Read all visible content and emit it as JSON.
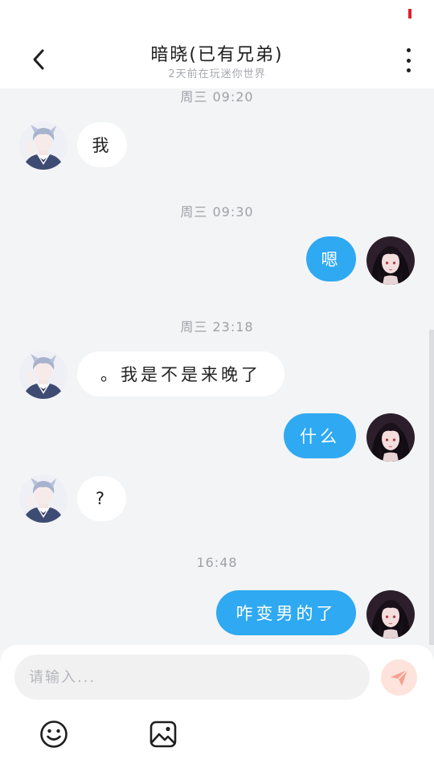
{
  "status_bar": {
    "indicator_color": "#e3222b"
  },
  "header": {
    "back_icon": "chevron-left-icon",
    "title": "暗晓(已有兄弟)",
    "subtitle": "2天前在玩迷你世界",
    "more_icon": "vertical-ellipsis-icon"
  },
  "messages": [
    {
      "type": "timestamp",
      "text": "周三 09:20"
    },
    {
      "type": "incoming",
      "text": "我",
      "avatar": "contact-avatar"
    },
    {
      "type": "timestamp",
      "text": "周三 09:30"
    },
    {
      "type": "outgoing",
      "text": "嗯",
      "avatar": "user-avatar"
    },
    {
      "type": "timestamp",
      "text": "周三 23:18"
    },
    {
      "type": "incoming",
      "text": "。我是不是来晚了",
      "avatar": "contact-avatar"
    },
    {
      "type": "outgoing",
      "text": "什么",
      "avatar": "user-avatar"
    },
    {
      "type": "incoming",
      "text": "?",
      "avatar": "contact-avatar"
    },
    {
      "type": "timestamp",
      "text": "16:48"
    },
    {
      "type": "outgoing",
      "text": "咋变男的了",
      "avatar": "user-avatar"
    }
  ],
  "composer": {
    "placeholder": "请输入...",
    "send_icon": "paper-plane-icon",
    "emoji_icon": "smiley-icon",
    "image_icon": "image-icon"
  },
  "colors": {
    "outgoing_bubble": "#2fa9f1",
    "incoming_bubble": "#ffffff",
    "background": "#f3f4f6",
    "send_button": "#fde3dc",
    "send_icon": "#f7a08e"
  }
}
